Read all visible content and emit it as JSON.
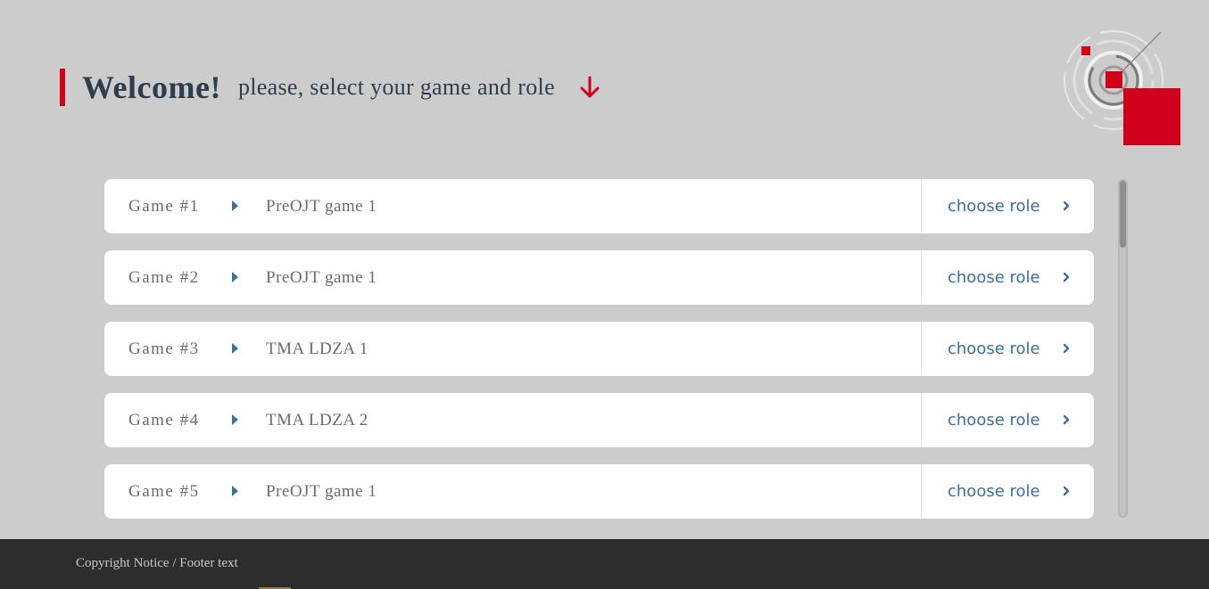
{
  "header": {
    "welcome": "Welcome!",
    "subtitle": "please, select your game and role",
    "arrow_icon": "arrow-down-icon",
    "accent_color": "#d0021b"
  },
  "games": [
    {
      "number": "Game #1",
      "name": "PreOJT game 1",
      "action": "choose role"
    },
    {
      "number": "Game #2",
      "name": "PreOJT game 1",
      "action": "choose role"
    },
    {
      "number": "Game #3",
      "name": "TMA LDZA 1",
      "action": "choose role"
    },
    {
      "number": "Game #4",
      "name": "TMA LDZA 2",
      "action": "choose role"
    },
    {
      "number": "Game #5",
      "name": "PreOJT game 1",
      "action": "choose role"
    }
  ],
  "footer": {
    "text": "Copyright Notice / Footer text"
  },
  "colors": {
    "background": "#cccccc",
    "heading": "#2c3e50",
    "link": "#3a6f9e",
    "footer_bg": "#2d2d2d"
  }
}
